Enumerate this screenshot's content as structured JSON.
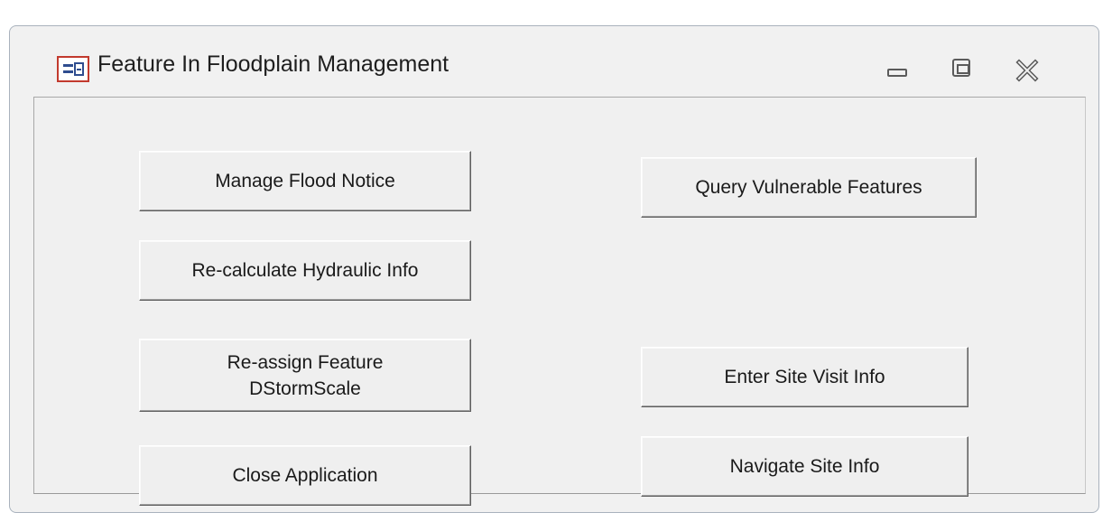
{
  "window": {
    "title": "Feature In Floodplain Management",
    "controls": {
      "minimize_icon": "minimize-icon",
      "maximize_icon": "restore-icon",
      "close_icon": "close-icon"
    }
  },
  "buttons": {
    "manage_flood_notice": "Manage Flood Notice",
    "query_vulnerable_features": "Query Vulnerable Features",
    "recalculate_hydraulic_info": "Re-calculate Hydraulic Info",
    "reassign_feature_dstormscale": "Re-assign Feature\nDStormScale",
    "enter_site_visit_info": "Enter Site Visit Info",
    "close_application": "Close Application",
    "navigate_site_info": "Navigate Site Info"
  },
  "colors": {
    "window_bg": "#f1f1f1",
    "icon_accent": "#c23a2e",
    "icon_blue": "#2f4d8f"
  }
}
